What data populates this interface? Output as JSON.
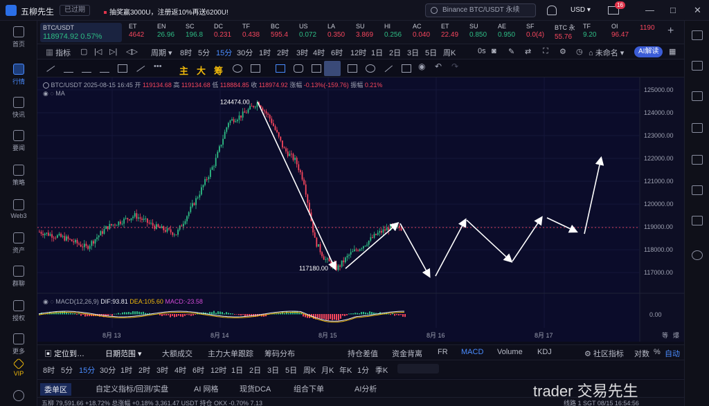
{
  "titlebar": {
    "app_name": "五柳先生",
    "status": "已过期",
    "promo": "抽奖赢3000U，注册返10%再送6200U!",
    "search_placeholder": "Binance BTC/USDT 永续",
    "currency": "USD",
    "mail_count": "16",
    "win_min": "—",
    "win_max": "□",
    "win_close": "✕"
  },
  "sidebar": [
    {
      "label": "首页",
      "icon": "home-icon"
    },
    {
      "label": "行情",
      "icon": "chart-bar-icon",
      "active": true
    },
    {
      "label": "快讯",
      "icon": "news-icon"
    },
    {
      "label": "要闻",
      "icon": "document-icon"
    },
    {
      "label": "策略",
      "icon": "strategy-icon"
    },
    {
      "label": "Web3",
      "icon": "web3-icon"
    },
    {
      "label": "资产",
      "icon": "wallet-icon"
    },
    {
      "label": "群聊",
      "icon": "chat-icon"
    },
    {
      "label": "授权",
      "icon": "key-icon"
    },
    {
      "label": "更多",
      "icon": "more-icon"
    },
    {
      "label": "VIP",
      "icon": "vip-icon"
    }
  ],
  "tickers": [
    {
      "name": "BTC/USDT",
      "price": "118974.92",
      "change": "0.57%"
    },
    {
      "name": "ET",
      "price": "4642"
    },
    {
      "name": "EN",
      "price": "26.96"
    },
    {
      "name": "SC",
      "price": "196.8"
    },
    {
      "name": "DC",
      "price": "0.231"
    },
    {
      "name": "TF",
      "price": "0.438"
    },
    {
      "name": "BC",
      "price": "595.4"
    },
    {
      "name": "US",
      "price": "0.072"
    },
    {
      "name": "LA",
      "price": "0.350"
    },
    {
      "name": "SU",
      "price": "3.869"
    },
    {
      "name": "HI",
      "price": "0.256"
    },
    {
      "name": "AC",
      "price": "0.040"
    },
    {
      "name": "ET",
      "price": "22.49"
    },
    {
      "name": "SU",
      "price": "0.850"
    },
    {
      "name": "AE",
      "price": "0.950"
    },
    {
      "name": "SF",
      "price": "0.0(4)"
    },
    {
      "name": "BTC 永",
      "price": "55.76"
    },
    {
      "name": "TF",
      "price": "9.20"
    },
    {
      "name": "OI",
      "price": "96.47"
    },
    {
      "name": "",
      "price": "1190"
    }
  ],
  "toolbar1": {
    "indicator": "指标",
    "period": "周期",
    "intervals": [
      "8时",
      "5分",
      "15分",
      "30分",
      "1时",
      "2时",
      "3时",
      "4时",
      "6时",
      "12时",
      "1日",
      "2日",
      "3日",
      "5日",
      "周K"
    ],
    "selected_interval": "15分",
    "seconds": "0s",
    "layout_name": "未命名",
    "ai_button": "AI解读"
  },
  "toolbar2": {
    "chars": [
      "主",
      "大",
      "筹"
    ]
  },
  "chart_info": {
    "symbol": "BTC/USDT",
    "time": "2025-08-15 16:45",
    "open_label": "开",
    "open": "119134.68",
    "high_label": "高",
    "high": "119134.68",
    "low_label": "低",
    "low": "118884.85",
    "close_label": "收",
    "close": "118974.92",
    "chg_label": "涨幅",
    "chg": "-0.13%(-159.76)",
    "amp_label": "振幅",
    "amp": "0.21%",
    "ma": "MA",
    "peak_label": "124474.00",
    "trough_label": "117180.00",
    "macd_name": "MACD(12,26,9)",
    "dif": "DIF:93.81",
    "dea": "DEA:105.60",
    "macd": "MACD:-23.58",
    "zero": "0.00"
  },
  "chart_data": {
    "type": "candlestick",
    "price_ticks": [
      "125000.00",
      "124000.00",
      "123000.00",
      "122000.00",
      "121000.00",
      "120000.00",
      "119000.00",
      "118000.00",
      "117000.00"
    ],
    "date_ticks": [
      "8月 13",
      "8月 14",
      "8月 15",
      "8月 16",
      "8月 17"
    ],
    "ylim": [
      116400,
      125300
    ],
    "annotations": [
      {
        "type": "arrow",
        "from": [
          124474,
          "8月 14 ~ 10:00"
        ],
        "to": [
          117180,
          "8月 15 ~ 02:00"
        ]
      },
      {
        "type": "projection_zigzag",
        "points": [
          117180,
          119150,
          116850,
          119300,
          117500,
          119400,
          118800,
          122000
        ]
      }
    ]
  },
  "bottom_tabs1": {
    "locate": "定位到…",
    "date_range": "日期范围",
    "tabs": [
      "大额成交",
      "主力大单跟踪",
      "筹码分布",
      "持仓差值",
      "资金背离",
      "FR",
      "MACD",
      "Volume",
      "KDJ"
    ],
    "community": "社区指标",
    "log": "对数",
    "pct": "%",
    "auto": "自动"
  },
  "bottom_tabs2": {
    "intervals": [
      "8时",
      "5分",
      "15分",
      "30分",
      "1时",
      "2时",
      "3时",
      "4时",
      "6时",
      "12时",
      "1日",
      "2日",
      "3日",
      "5日",
      "周K",
      "月K",
      "年K",
      "1分",
      "季K"
    ]
  },
  "bottom_tabs3": {
    "tabs": [
      "委单区",
      "自定义指标/回测/实盘",
      "AI 网格",
      "现货DCA",
      "组合下单",
      "AI分析"
    ]
  },
  "status_bar": {
    "left": "五柳 79,591.66 +18.72%   总涨幅 +0.18%  3,361.47   USDT 持仓 OKX -0.70% 7.13",
    "right": "线路 1   SGT 08/15 16:54:56"
  },
  "watermark": "trader 交易先生"
}
